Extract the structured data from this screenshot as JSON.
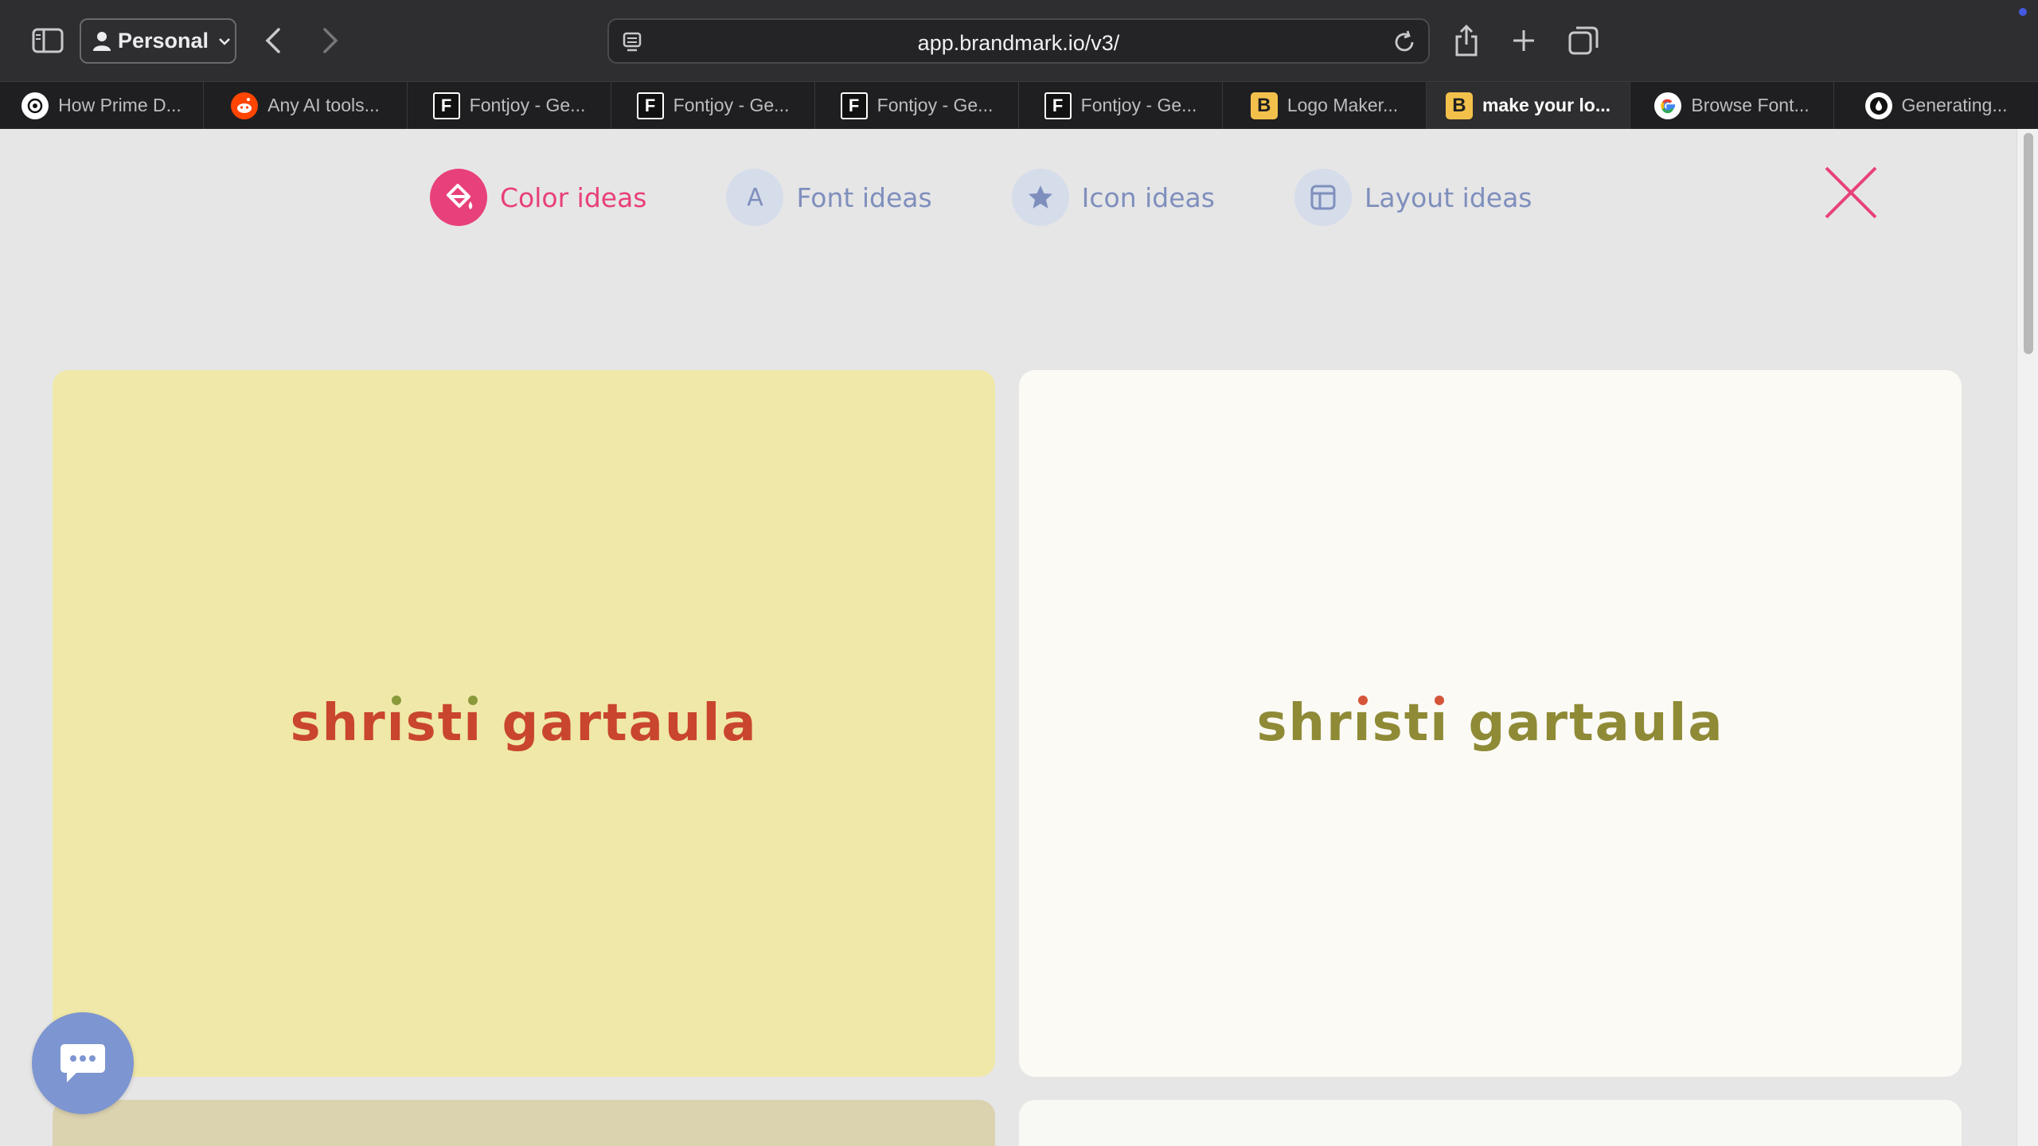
{
  "browser": {
    "profile_label": "Personal",
    "url": "app.brandmark.io/v3/"
  },
  "tabs": [
    {
      "title": "How Prime D...",
      "favicon": "openai-icon",
      "active": false
    },
    {
      "title": "Any AI tools...",
      "favicon": "reddit-icon",
      "active": false
    },
    {
      "title": "Fontjoy - Ge...",
      "favicon": "fontjoy-icon",
      "active": false
    },
    {
      "title": "Fontjoy - Ge...",
      "favicon": "fontjoy-icon",
      "active": false
    },
    {
      "title": "Fontjoy - Ge...",
      "favicon": "fontjoy-icon",
      "active": false
    },
    {
      "title": "Fontjoy - Ge...",
      "favicon": "fontjoy-icon",
      "active": false
    },
    {
      "title": "Logo Maker...",
      "favicon": "brandmark-icon",
      "active": false
    },
    {
      "title": "make your lo...",
      "favicon": "brandmark-icon",
      "active": true
    },
    {
      "title": "Browse Font...",
      "favicon": "google-icon",
      "active": false
    },
    {
      "title": "Generating...",
      "favicon": "drop-icon",
      "active": false
    }
  ],
  "ideas_nav": {
    "color": "Color ideas",
    "font": "Font ideas",
    "font_glyph": "A",
    "icon": "Icon ideas",
    "layout": "Layout ideas"
  },
  "cards": [
    {
      "background": "#f0e8a8",
      "text": "shristi gartaula",
      "text_color": "#c9452e",
      "dot_color": "#8a9a3a"
    },
    {
      "background": "#fcfaf5",
      "text": "shristi gartaula",
      "text_color": "#8f8a36",
      "dot_color": "#d5553a"
    },
    {
      "background": "#dbd2b0"
    },
    {
      "background": "#f8f8f4"
    }
  ],
  "colors": {
    "accent": "#e8407a",
    "muted": "#7f8fbd",
    "chat": "#7d95d0"
  }
}
